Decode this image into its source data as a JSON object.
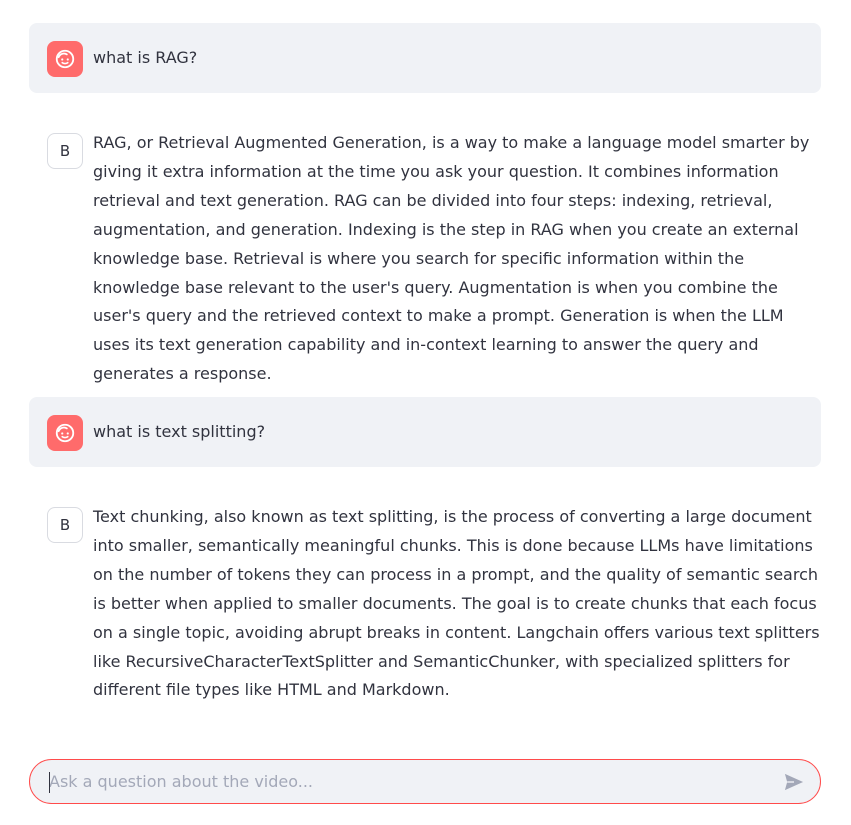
{
  "messages": [
    {
      "role": "user",
      "avatar_icon": "smiling-face-icon",
      "text": "what is RAG?"
    },
    {
      "role": "assistant",
      "avatar_label": "B",
      "text": "RAG, or Retrieval Augmented Generation, is a way to make a language model smarter by giving it extra information at the time you ask your question. It combines information retrieval and text generation. RAG can be divided into four steps: indexing, retrieval, augmentation, and generation. Indexing is the step in RAG when you create an external knowledge base. Retrieval is where you search for specific information within the knowledge base relevant to the user's query. Augmentation is when you combine the user's query and the retrieved context to make a prompt. Generation is when the LLM uses its text generation capability and in-context learning to answer the query and generates a response."
    },
    {
      "role": "user",
      "avatar_icon": "smiling-face-icon",
      "text": "what is text splitting?"
    },
    {
      "role": "assistant",
      "avatar_label": "B",
      "text": "Text chunking, also known as text splitting, is the process of converting a large document into smaller, semantically meaningful chunks. This is done because LLMs have limitations on the number of tokens they can process in a prompt, and the quality of semantic search is better when applied to smaller documents. The goal is to create chunks that each focus on a single topic, avoiding abrupt breaks in content. Langchain offers various text splitters like RecursiveCharacterTextSplitter and SemanticChunker, with specialized splitters for different file types like HTML and Markdown."
    }
  ],
  "chat_input": {
    "value": "",
    "placeholder": "Ask a question about the video...",
    "send_icon": "send-arrow-icon"
  },
  "colors": {
    "user_bubble_bg": "#f0f2f6",
    "user_avatar_bg": "#ff6b6b",
    "input_border_focus": "#ff4b4b",
    "text": "#31333f",
    "placeholder": "#a3a8b8"
  }
}
